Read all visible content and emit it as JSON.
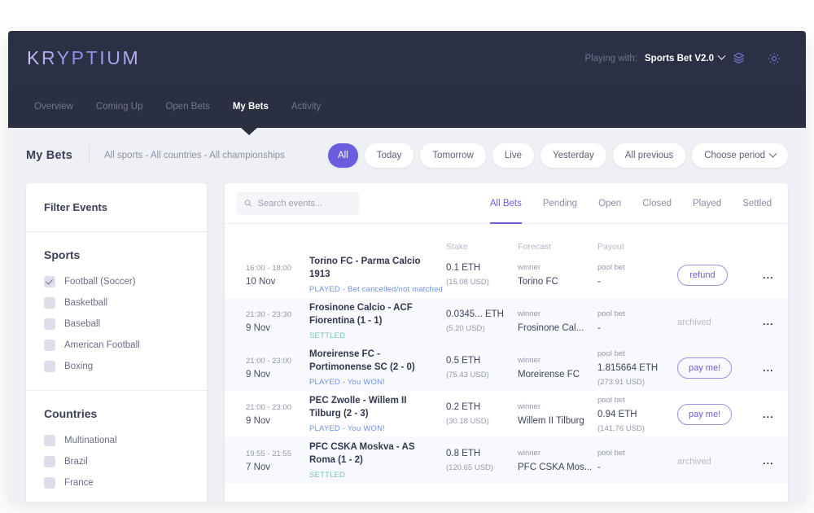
{
  "header": {
    "logo": "KRYPTIUM",
    "playing_with_label": "Playing with:",
    "playing_with_value": "Sports Bet V2.0",
    "icons": [
      "layers-icon",
      "gear-icon"
    ]
  },
  "nav": {
    "items": [
      {
        "label": "Overview",
        "active": false
      },
      {
        "label": "Coming Up",
        "active": false
      },
      {
        "label": "Open Bets",
        "active": false
      },
      {
        "label": "My Bets",
        "active": true
      },
      {
        "label": "Activity",
        "active": false
      }
    ]
  },
  "filterbar": {
    "title": "My Bets",
    "breadcrumb": "All sports  -  All countries  -  All championships",
    "pills": [
      {
        "label": "All",
        "active": true,
        "chevron": false
      },
      {
        "label": "Today",
        "active": false,
        "chevron": false
      },
      {
        "label": "Tomorrow",
        "active": false,
        "chevron": false
      },
      {
        "label": "Live",
        "active": false,
        "chevron": false
      },
      {
        "label": "Yesterday",
        "active": false,
        "chevron": false
      },
      {
        "label": "All previous",
        "active": false,
        "chevron": false
      },
      {
        "label": "Choose period",
        "active": false,
        "chevron": true
      }
    ]
  },
  "sidebar": {
    "heading": "Filter Events",
    "sections": [
      {
        "title": "Sports",
        "options": [
          {
            "label": "Football (Soccer)",
            "checked": true
          },
          {
            "label": "Basketball",
            "checked": false
          },
          {
            "label": "Baseball",
            "checked": false
          },
          {
            "label": "American Football",
            "checked": false
          },
          {
            "label": "Boxing",
            "checked": false
          }
        ]
      },
      {
        "title": "Countries",
        "options": [
          {
            "label": "Multinational",
            "checked": false
          },
          {
            "label": "Brazil",
            "checked": false
          },
          {
            "label": "France",
            "checked": false
          }
        ]
      }
    ]
  },
  "panel": {
    "search_placeholder": "Search events...",
    "search_value": "",
    "tabs": [
      {
        "label": "All Bets",
        "active": true
      },
      {
        "label": "Pending",
        "active": false
      },
      {
        "label": "Open",
        "active": false
      },
      {
        "label": "Closed",
        "active": false
      },
      {
        "label": "Played",
        "active": false
      },
      {
        "label": "Settled",
        "active": false
      }
    ],
    "columns": {
      "time": "",
      "event": "",
      "stake": "Stake",
      "forecast": "Forecast",
      "payout": "Payout"
    },
    "rows": [
      {
        "time": "16:00 - 18:00",
        "date": "10 Nov",
        "event": "Torino FC - Parma Calcio 1913",
        "status": "PLAYED - Bet cancelled/not matched",
        "status_kind": "played",
        "stake": "0.1 ETH",
        "stake_usd": "(15.08 USD)",
        "forecast_label": "winner",
        "forecast_value": "Torino FC",
        "payout_label": "pool bet",
        "payout_value": "-",
        "payout_usd": "",
        "action": "refund",
        "action_kind": "button",
        "more": "...",
        "alt": false
      },
      {
        "time": "21:30 - 23:30",
        "date": "9 Nov",
        "event": "Frosinone Calcio - ACF Fiorentina (1 - 1)",
        "status": "SETTLED",
        "status_kind": "settled",
        "stake": "0.0345...  ETH",
        "stake_usd": "(5.20 USD)",
        "forecast_label": "winner",
        "forecast_value": "Frosinone Cal...",
        "payout_label": "pool bet",
        "payout_value": "-",
        "payout_usd": "",
        "action": "archived",
        "action_kind": "muted",
        "more": "...",
        "alt": true
      },
      {
        "time": "21:00 - 23:00",
        "date": "9 Nov",
        "event": "Moreirense FC - Portimonense SC (2 - 0)",
        "status": "PLAYED - You WON!",
        "status_kind": "played",
        "stake": "0.5 ETH",
        "stake_usd": "(75.43 USD)",
        "forecast_label": "winner",
        "forecast_value": "Moreirense FC",
        "payout_label": "pool bet",
        "payout_value": "1.815664 ETH",
        "payout_usd": "(273.91 USD)",
        "action": "pay me!",
        "action_kind": "button",
        "more": "...",
        "alt": true
      },
      {
        "time": "21:00 - 23:00",
        "date": "9 Nov",
        "event": "PEC Zwolle - Willem II Tilburg (2 - 3)",
        "status": "PLAYED - You WON!",
        "status_kind": "played",
        "stake": "0.2 ETH",
        "stake_usd": "(30.18 USD)",
        "forecast_label": "winner",
        "forecast_value": "Willem II Tilburg",
        "payout_label": "pool bet",
        "payout_value": "0.94 ETH",
        "payout_usd": "(141.76 USD)",
        "action": "pay me!",
        "action_kind": "button",
        "more": "...",
        "alt": false
      },
      {
        "time": "19:55 - 21:55",
        "date": "7 Nov",
        "event": "PFC CSKA Moskva - AS Roma (1 - 2)",
        "status": "SETTLED",
        "status_kind": "settled",
        "stake": "0.8 ETH",
        "stake_usd": "(120.65 USD)",
        "forecast_label": "winner",
        "forecast_value": "PFC CSKA Mos...",
        "payout_label": "pool bet",
        "payout_value": "-",
        "payout_usd": "",
        "action": "archived",
        "action_kind": "muted",
        "more": "...",
        "alt": true
      }
    ]
  },
  "colors": {
    "accent": "#6c5ce0",
    "header_bg": "#2c3044",
    "nav_bg": "#2b2f42",
    "page_bg": "#eef0f5",
    "status_played": "#6f8fe8",
    "status_settled": "#74c6b0"
  }
}
